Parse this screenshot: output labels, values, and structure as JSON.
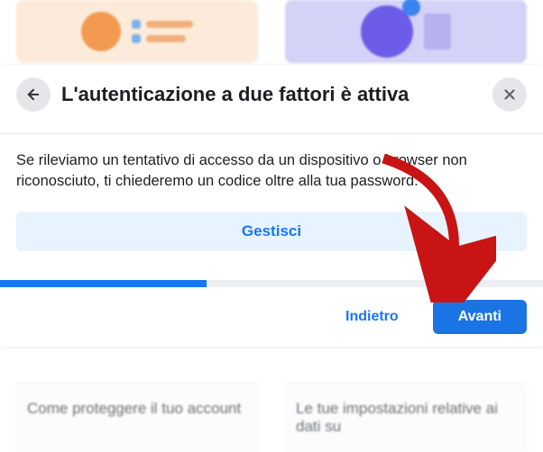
{
  "modal": {
    "title": "L'autenticazione a due fattori è attiva",
    "description": "Se rileviamo un tentativo di accesso da un dispositivo o browser non riconosciuto, ti chiederemo un codice oltre alla tua password.",
    "manage_label": "Gestisci",
    "back_label": "Indietro",
    "next_label": "Avanti",
    "progress_width": "38%"
  },
  "background": {
    "card1_label": "Come proteggere il tuo account",
    "card2_label": "Le tue impostazioni relative ai dati su"
  }
}
